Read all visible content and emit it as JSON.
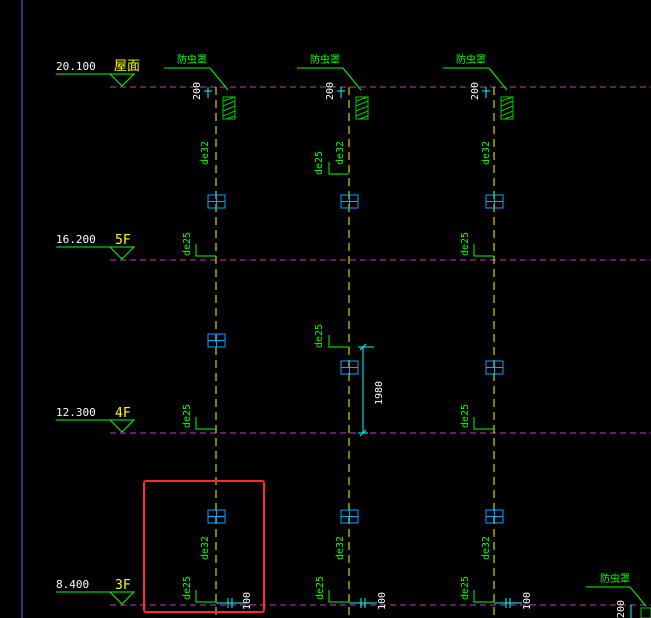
{
  "colors": {
    "background": "#000000",
    "floor_line": "#c040c0",
    "pipe": "#ffff00",
    "level_text": "#ffffff",
    "floor_name": "#ffff00",
    "pipe_label": "#00ff00",
    "dimension": "#00ffff",
    "fitting": "#00aaff",
    "selection_box": "#ff2a2a",
    "hatch": "#00cc00",
    "left_border": "#6a6aff"
  },
  "levels": [
    {
      "elevation": "20.100",
      "floor": "屋面"
    },
    {
      "elevation": "16.200",
      "floor": "5F"
    },
    {
      "elevation": "12.300",
      "floor": "4F"
    },
    {
      "elevation": "8.400",
      "floor": "3F"
    }
  ],
  "labels": {
    "vent_cap": "防虫罩",
    "dim_200": "200",
    "dim_100": "100",
    "dim_1980": "1980",
    "de32": "de32",
    "de25": "de25"
  },
  "selection": {
    "icon": "selection-box"
  }
}
